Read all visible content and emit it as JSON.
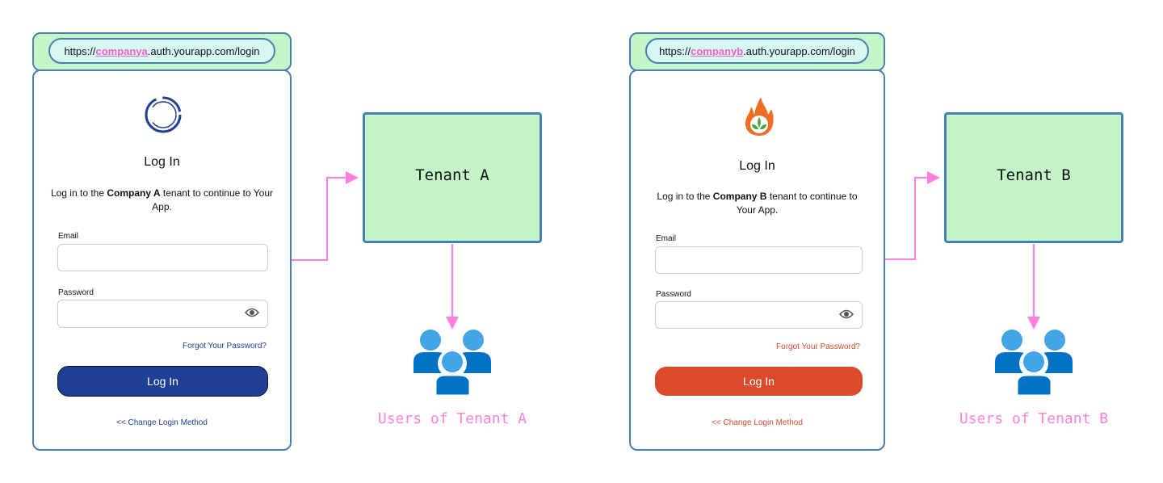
{
  "colors": {
    "arrow": "#ff7fe0",
    "border": "#4a7fb5",
    "tenant_bg": "#c4f5c8",
    "company_a_accent": "#1f3f94",
    "company_b_accent": "#d94b2b",
    "user_icon_light": "#42a5e8",
    "user_icon_dark": "#0072c6"
  },
  "panels": [
    {
      "url_prefix": "https://",
      "url_highlight": "companya",
      "url_suffix": ".auth.yourapp.com/login",
      "logo_icon": "ring-swirl-logo",
      "title": "Log In",
      "desc_pre": "Log in to the ",
      "desc_bold": "Company A",
      "desc_post": " tenant to continue to Your App.",
      "email_label": "Email",
      "email_value": "",
      "password_label": "Password",
      "password_value": "",
      "forgot": "Forgot Your Password?",
      "login_button": "Log In",
      "change_method": "<< Change Login Method",
      "tenant": "Tenant A",
      "users_label": "Users of Tenant A"
    },
    {
      "url_prefix": "https://",
      "url_highlight": "companyb",
      "url_suffix": ".auth.yourapp.com/login",
      "logo_icon": "flame-leaf-logo",
      "title": "Log In",
      "desc_pre": "Log in to the ",
      "desc_bold": "Company B",
      "desc_post": " tenant to continue to Your App.",
      "email_label": "Email",
      "email_value": "",
      "password_label": "Password",
      "password_value": "",
      "forgot": "Forgot Your Password?",
      "login_button": "Log In",
      "change_method": "<< Change Login Method",
      "tenant": "Tenant B",
      "users_label": "Users of Tenant B"
    }
  ]
}
